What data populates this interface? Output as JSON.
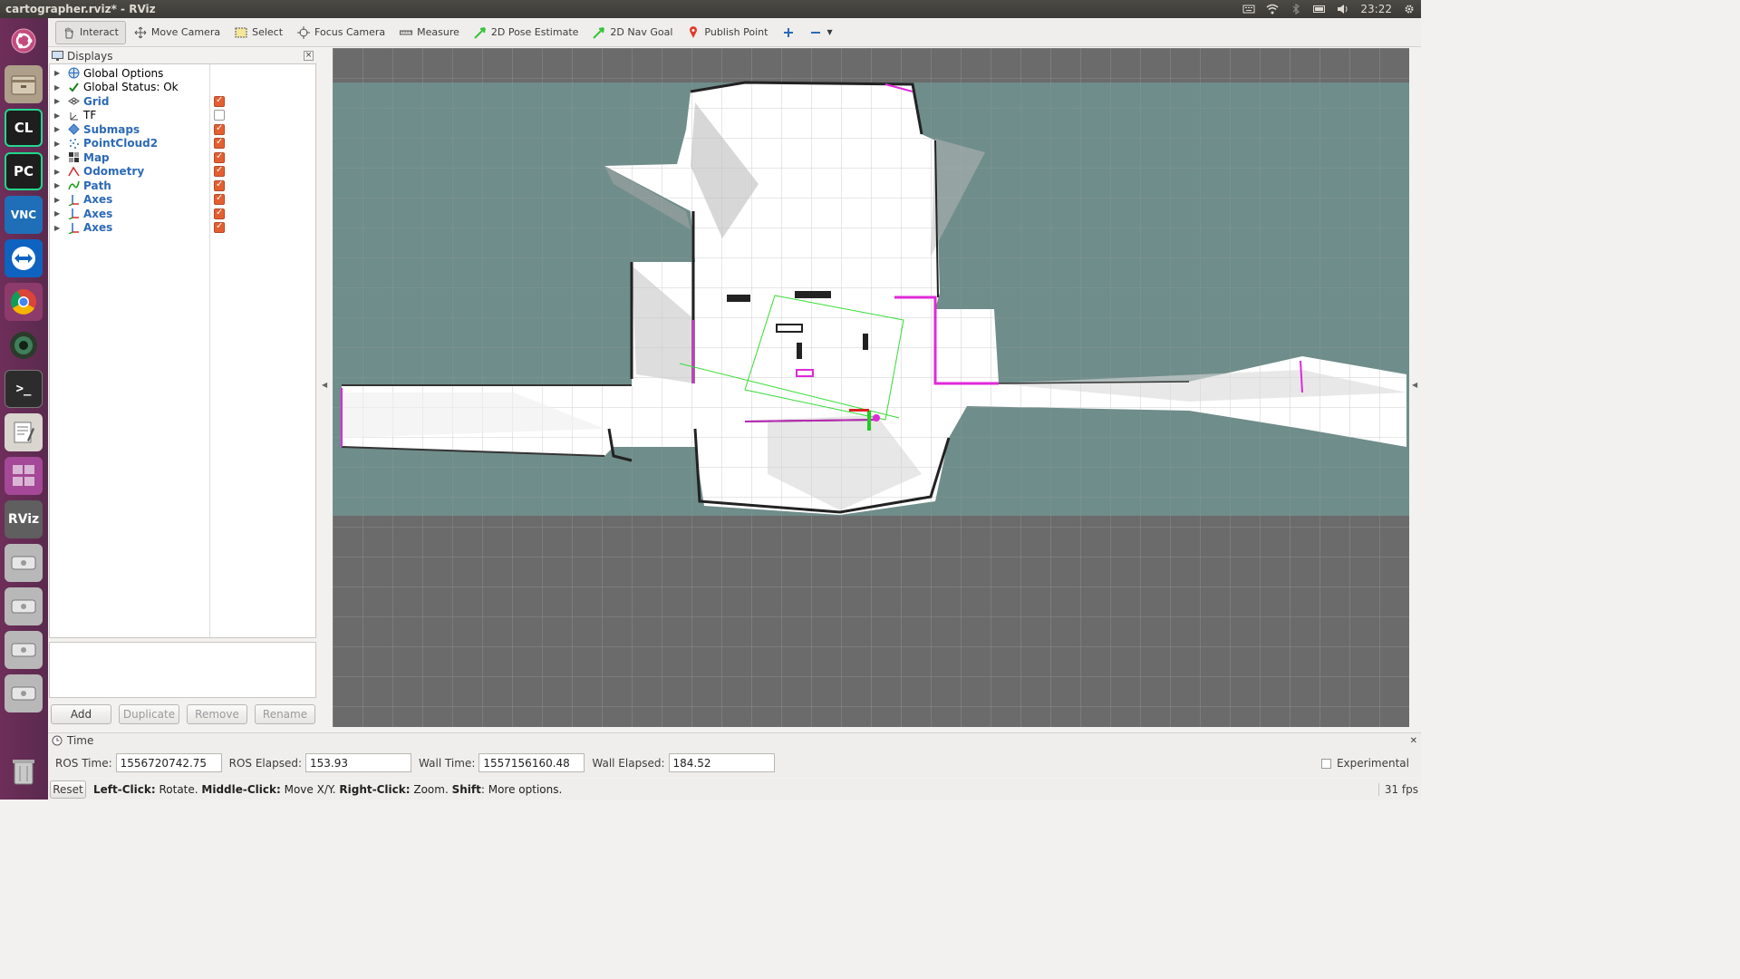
{
  "window": {
    "title": "cartographer.rviz* - RViz"
  },
  "system_tray": {
    "clock": "23:22",
    "icons": [
      "keyboard-icon",
      "wifi-icon",
      "bluetooth-icon",
      "battery-icon",
      "volume-icon",
      "gear-icon"
    ]
  },
  "launcher": {
    "items": [
      {
        "name": "ubuntu-dash",
        "label": ""
      },
      {
        "name": "files",
        "label": ""
      },
      {
        "name": "clion",
        "label": "CL"
      },
      {
        "name": "pycharm",
        "label": "PC"
      },
      {
        "name": "vnc-viewer",
        "label": "VNC"
      },
      {
        "name": "teamviewer",
        "label": ""
      },
      {
        "name": "chrome",
        "label": ""
      },
      {
        "name": "camera",
        "label": ""
      },
      {
        "name": "terminal",
        "label": ">_"
      },
      {
        "name": "text-editor",
        "label": ""
      },
      {
        "name": "workspace",
        "label": ""
      },
      {
        "name": "rviz",
        "label": "RViz"
      },
      {
        "name": "drive-1",
        "label": ""
      },
      {
        "name": "drive-2",
        "label": ""
      },
      {
        "name": "drive-3",
        "label": ""
      },
      {
        "name": "drive-4",
        "label": ""
      },
      {
        "name": "trash",
        "label": ""
      }
    ]
  },
  "toolbar": {
    "tools": [
      {
        "label": "Interact",
        "icon": "hand-icon",
        "color": "#555555"
      },
      {
        "label": "Move Camera",
        "icon": "move-camera-icon",
        "color": "#555555"
      },
      {
        "label": "Select",
        "icon": "select-icon",
        "color": "#d6c24a"
      },
      {
        "label": "Focus Camera",
        "icon": "focus-camera-icon",
        "color": "#555555"
      },
      {
        "label": "Measure",
        "icon": "measure-icon",
        "color": "#555555"
      },
      {
        "label": "2D Pose Estimate",
        "icon": "pose-arrow-icon",
        "color": "#35c435"
      },
      {
        "label": "2D Nav Goal",
        "icon": "nav-arrow-icon",
        "color": "#35c435"
      },
      {
        "label": "Publish Point",
        "icon": "pin-icon",
        "color": "#e23b2b"
      }
    ],
    "add_tool_icon": "plus-icon",
    "remove_tool_icon": "minus-icon"
  },
  "displays": {
    "title": "Displays",
    "items": [
      {
        "label": "Global Options",
        "checked": null,
        "blue": false,
        "icon": "globe-icon"
      },
      {
        "label": "Global Status: Ok",
        "checked": null,
        "blue": false,
        "icon": "check-icon"
      },
      {
        "label": "Grid",
        "checked": true,
        "blue": true,
        "icon": "grid-icon"
      },
      {
        "label": "TF",
        "checked": false,
        "blue": false,
        "icon": "tf-icon"
      },
      {
        "label": "Submaps",
        "checked": true,
        "blue": true,
        "icon": "submaps-icon"
      },
      {
        "label": "PointCloud2",
        "checked": true,
        "blue": true,
        "icon": "pointcloud-icon"
      },
      {
        "label": "Map",
        "checked": true,
        "blue": true,
        "icon": "map-icon"
      },
      {
        "label": "Odometry",
        "checked": true,
        "blue": true,
        "icon": "odometry-icon"
      },
      {
        "label": "Path",
        "checked": true,
        "blue": true,
        "icon": "path-icon"
      },
      {
        "label": "Axes",
        "checked": true,
        "blue": true,
        "icon": "axes-icon"
      },
      {
        "label": "Axes",
        "checked": true,
        "blue": true,
        "icon": "axes-icon"
      },
      {
        "label": "Axes",
        "checked": true,
        "blue": true,
        "icon": "axes-icon"
      }
    ],
    "buttons": {
      "add": "Add",
      "duplicate": "Duplicate",
      "remove": "Remove",
      "rename": "Rename"
    }
  },
  "time": {
    "title": "Time",
    "ros_time_label": "ROS Time:",
    "ros_time": "1556720742.75",
    "ros_elapsed_label": "ROS Elapsed:",
    "ros_elapsed": "153.93",
    "wall_time_label": "Wall Time:",
    "wall_time": "1557156160.48",
    "wall_elapsed_label": "Wall Elapsed:",
    "wall_elapsed": "184.52",
    "experimental_label": "Experimental"
  },
  "status": {
    "reset": "Reset",
    "help_parts": [
      {
        "bold": "Left-Click:",
        "text": " Rotate. "
      },
      {
        "bold": "Middle-Click:",
        "text": " Move X/Y. "
      },
      {
        "bold": "Right-Click:",
        "text": ": Zoom. "
      },
      {
        "bold": "Shift",
        "text": ": More options."
      }
    ],
    "fps": "31 fps"
  }
}
